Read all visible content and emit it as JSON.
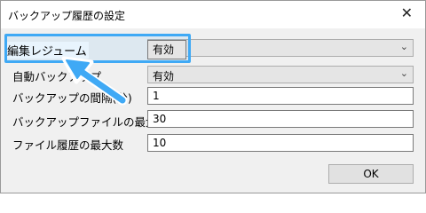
{
  "window": {
    "title": "バックアップ履歴の設定",
    "close_glyph": "✕"
  },
  "settings": [
    {
      "label": "編集レジューム",
      "type": "combo",
      "value": "有効"
    },
    {
      "label": "自動バックアップ",
      "type": "combo",
      "value": "有効"
    },
    {
      "label": "バックアップの間隔(分)",
      "type": "text",
      "value": "1"
    },
    {
      "label": "バックアップファイルの最大数",
      "type": "text",
      "value": "30"
    },
    {
      "label": "ファイル履歴の最大数",
      "type": "text",
      "value": "10"
    }
  ],
  "buttons": {
    "ok": "OK"
  },
  "icons": {
    "dropdown": "chevron-down-icon",
    "close": "close-icon",
    "callout": "arrow-callout"
  },
  "colors": {
    "highlight": "#3fa9f5",
    "panel": "#f0f0f0"
  }
}
